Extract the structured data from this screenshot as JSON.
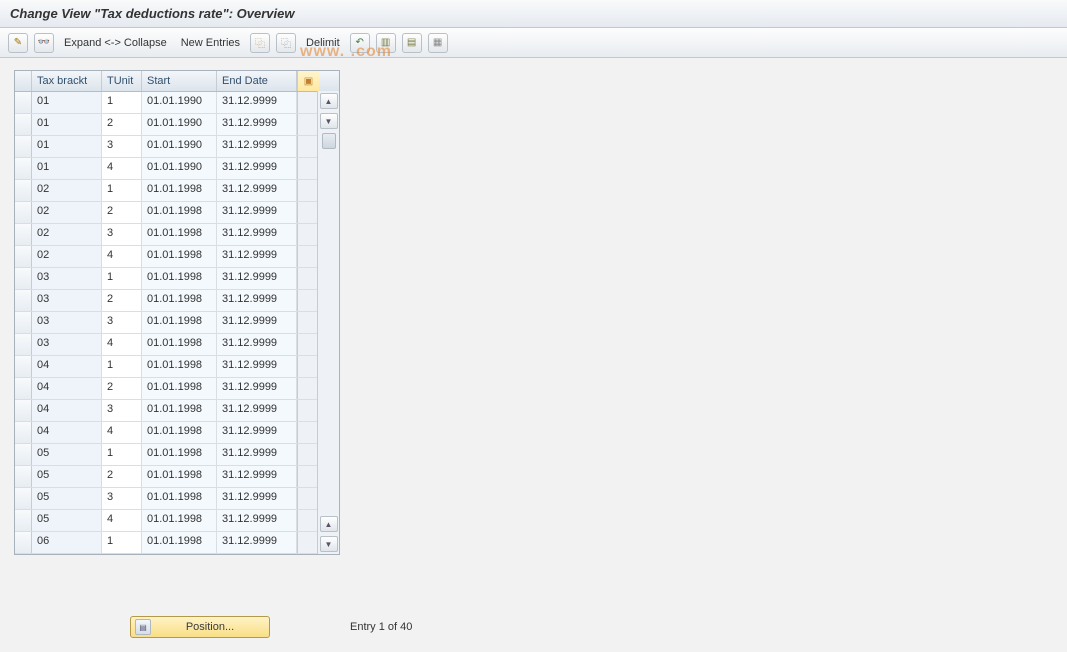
{
  "title": "Change View \"Tax deductions rate\": Overview",
  "toolbar": {
    "expand_collapse": "Expand <-> Collapse",
    "new_entries": "New Entries",
    "delimit": "Delimit"
  },
  "watermark": "www.                       .com",
  "columns": {
    "tax_bracket": "Tax brackt",
    "tunit": "TUnit",
    "start": "Start",
    "end": "End Date"
  },
  "rows": [
    {
      "tax": "01",
      "tunit": "1",
      "start": "01.01.1990",
      "end": "31.12.9999"
    },
    {
      "tax": "01",
      "tunit": "2",
      "start": "01.01.1990",
      "end": "31.12.9999"
    },
    {
      "tax": "01",
      "tunit": "3",
      "start": "01.01.1990",
      "end": "31.12.9999"
    },
    {
      "tax": "01",
      "tunit": "4",
      "start": "01.01.1990",
      "end": "31.12.9999"
    },
    {
      "tax": "02",
      "tunit": "1",
      "start": "01.01.1998",
      "end": "31.12.9999"
    },
    {
      "tax": "02",
      "tunit": "2",
      "start": "01.01.1998",
      "end": "31.12.9999"
    },
    {
      "tax": "02",
      "tunit": "3",
      "start": "01.01.1998",
      "end": "31.12.9999"
    },
    {
      "tax": "02",
      "tunit": "4",
      "start": "01.01.1998",
      "end": "31.12.9999"
    },
    {
      "tax": "03",
      "tunit": "1",
      "start": "01.01.1998",
      "end": "31.12.9999"
    },
    {
      "tax": "03",
      "tunit": "2",
      "start": "01.01.1998",
      "end": "31.12.9999"
    },
    {
      "tax": "03",
      "tunit": "3",
      "start": "01.01.1998",
      "end": "31.12.9999"
    },
    {
      "tax": "03",
      "tunit": "4",
      "start": "01.01.1998",
      "end": "31.12.9999"
    },
    {
      "tax": "04",
      "tunit": "1",
      "start": "01.01.1998",
      "end": "31.12.9999"
    },
    {
      "tax": "04",
      "tunit": "2",
      "start": "01.01.1998",
      "end": "31.12.9999"
    },
    {
      "tax": "04",
      "tunit": "3",
      "start": "01.01.1998",
      "end": "31.12.9999"
    },
    {
      "tax": "04",
      "tunit": "4",
      "start": "01.01.1998",
      "end": "31.12.9999"
    },
    {
      "tax": "05",
      "tunit": "1",
      "start": "01.01.1998",
      "end": "31.12.9999"
    },
    {
      "tax": "05",
      "tunit": "2",
      "start": "01.01.1998",
      "end": "31.12.9999"
    },
    {
      "tax": "05",
      "tunit": "3",
      "start": "01.01.1998",
      "end": "31.12.9999"
    },
    {
      "tax": "05",
      "tunit": "4",
      "start": "01.01.1998",
      "end": "31.12.9999"
    },
    {
      "tax": "06",
      "tunit": "1",
      "start": "01.01.1998",
      "end": "31.12.9999"
    }
  ],
  "position_button": "Position...",
  "entry_status": "Entry 1 of 40"
}
